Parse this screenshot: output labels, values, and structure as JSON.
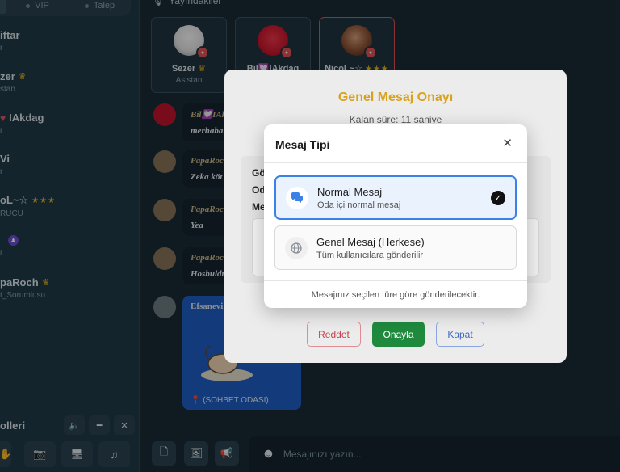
{
  "sidebar": {
    "tabs": [
      {
        "label": "VIP"
      },
      {
        "label": "Talep"
      }
    ],
    "users": [
      {
        "name": "iftar",
        "role": "r"
      },
      {
        "name": "zer",
        "role": "stan"
      },
      {
        "name": "IAkdag",
        "role": "r"
      },
      {
        "name": "Vi",
        "role": "r"
      },
      {
        "name": "oL~☆",
        "role": "RUCU"
      },
      {
        "name": "",
        "role": "r"
      },
      {
        "name": "paRoch",
        "role": "t_Sorumlusu"
      }
    ],
    "controls_title": "olleri"
  },
  "main": {
    "live_header": "Yayındakiler",
    "streamers": [
      {
        "name": "Sezer",
        "role": "Asistan"
      },
      {
        "name": "Bil💟IAkdag",
        "role": ""
      },
      {
        "name": "NicoL~☆",
        "role": ""
      }
    ],
    "messages": [
      {
        "name": "Bil💟IAk",
        "text": "merhaba"
      },
      {
        "name": "PapaRoc",
        "text": "Zeka köt"
      },
      {
        "name": "PapaRoc",
        "text": "Yea"
      },
      {
        "name": "PapaRoc",
        "text": "Hosbuldu"
      }
    ],
    "image_message": {
      "name": "Efsanevi",
      "location": "📍 (SOHBET ODASI)"
    },
    "input_placeholder": "Mesajınızı yazın..."
  },
  "approval_dialog": {
    "title": "Genel Mesaj Onayı",
    "countdown": "Kalan süre: 11 saniye",
    "fields": [
      "Gö",
      "Od",
      "Me"
    ],
    "reject_label": "Reddet",
    "approve_label": "Onayla",
    "close_label": "Kapat"
  },
  "message_type_modal": {
    "title": "Mesaj Tipi",
    "close_glyph": "✕",
    "options": [
      {
        "title": "Normal Mesaj",
        "subtitle": "Oda içi normal mesaj",
        "icon": "chat-bubbles-icon",
        "selected": true
      },
      {
        "title": "Genel Mesaj (Herkese)",
        "subtitle": "Tüm kullanıcılara gönderilir",
        "icon": "globe-icon",
        "selected": false
      }
    ],
    "footer": "Mesajınız seçilen türe göre gönderilecektir."
  },
  "colors": {
    "accent_gold": "#d9a21b",
    "approve_green": "#1f8a3e",
    "reject_red": "#c6414d",
    "close_blue": "#3f67c2",
    "selected_blue": "#3b82e6"
  }
}
